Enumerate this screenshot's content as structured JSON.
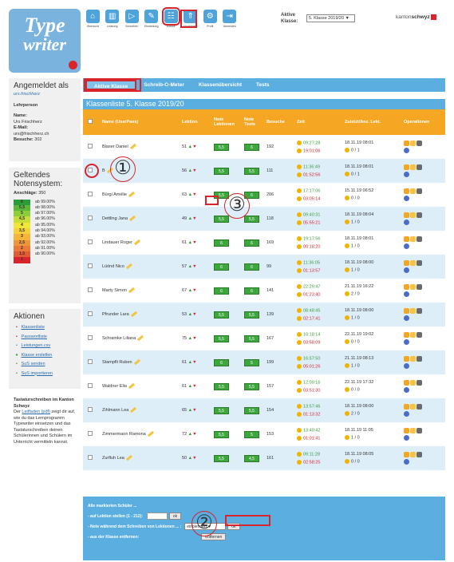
{
  "logo": {
    "line1": "Type",
    "line2": "writer"
  },
  "nav": [
    {
      "label": "Übersicht",
      "icon": "⌂"
    },
    {
      "label": "Leistung",
      "icon": "▥"
    },
    {
      "label": "Schreiben",
      "icon": "▷"
    },
    {
      "label": "Einstellung",
      "icon": "✎"
    },
    {
      "label": "Klasse",
      "icon": "☷"
    },
    {
      "label": "Hochladen",
      "icon": "⇑"
    },
    {
      "label": "Profil",
      "icon": "⚙"
    },
    {
      "label": "Abmelden",
      "icon": "⇥"
    }
  ],
  "klasse": {
    "label": "Aktive\nKlasse:",
    "value": "5. Klasse 2019/20 ▼"
  },
  "brand": {
    "text": "kanton",
    "bold": "schwyz"
  },
  "sidebar": {
    "heading": "Angemeldet als",
    "user": "urs.frischherz",
    "role": "Lehrperson",
    "name_label": "Name:",
    "name": "Urs Frischherz",
    "email_label": "E-Mail:",
    "email": "urs@frischherz.ch",
    "visits_label": "Besuche:",
    "visits": "302",
    "grading_heading": "Geltendes Notensystem:",
    "keystrokes_label": "Anschläge:",
    "keystrokes": "350",
    "notes": [
      {
        "g": "6",
        "p": "ab 99.00%",
        "c": "#2a9d3a"
      },
      {
        "g": "5,5",
        "p": "ab 98.00%",
        "c": "#5cb83a"
      },
      {
        "g": "5",
        "p": "ab 97.00%",
        "c": "#8ccd3a"
      },
      {
        "g": "4,5",
        "p": "ab 96.00%",
        "c": "#c8dc3a"
      },
      {
        "g": "4",
        "p": "ab 95.00%",
        "c": "#f0e63a"
      },
      {
        "g": "3,5",
        "p": "ab 94.00%",
        "c": "#f5d03a"
      },
      {
        "g": "3",
        "p": "ab 93.00%",
        "c": "#f5b43a"
      },
      {
        "g": "2,5",
        "p": "ab 92.00%",
        "c": "#f0963a"
      },
      {
        "g": "2",
        "p": "ab 91.00%",
        "c": "#eb7a3a"
      },
      {
        "g": "1,5",
        "p": "ab 90.00%",
        "c": "#e45a34"
      },
      {
        "g": "1",
        "p": "",
        "c": "#d8242b"
      }
    ],
    "actions_heading": "Aktionen",
    "actions": [
      {
        "label": "Klassenliste",
        "icon": "▪",
        "c": "#d8242b"
      },
      {
        "label": "Passwortliste",
        "icon": "▪",
        "c": "#d8242b"
      },
      {
        "label": "Leistungen.csv",
        "icon": "▪",
        "c": "#5a8ec8"
      },
      {
        "label": "Klasse erstellen",
        "icon": "●",
        "c": "#3a9d3a"
      },
      {
        "label": "SuS senden",
        "icon": "▪",
        "c": "#6a8a4a"
      },
      {
        "label": "SuS importieren",
        "icon": "▪",
        "c": "#6a8a4a"
      }
    ],
    "info_heading": "Tastaturschreiben im Kanton Schwyz",
    "info_pre": "Der",
    "info_link": "Leitfaden (pdf)",
    "info_post": "zeigt dir auf, wie du das Lernprogramm Typewriter einsetzen und das Tastaturschreiben deinen Schülerinnen und Schülern im Unterricht vermitteln kannst."
  },
  "tabs": [
    "Aktive Klasse",
    "Schreib-O-Meter",
    "Klassenübersicht",
    "Tests"
  ],
  "list_title": "Klassenliste 5. Klasse 2019/20",
  "headers": {
    "name": "Name (UserPass)",
    "lektion": "Lektion",
    "note_lek": "Note Lektionen",
    "note_tests": "Note Tests",
    "besuche": "Besuche",
    "zeit": "Zeit",
    "zuletzt": "Zuletzt/Anz. Lekt.",
    "op": "Operationen"
  },
  "students": [
    {
      "name": "Blaser Daniel",
      "lek": "51",
      "nl": "5,5",
      "nt": "6",
      "bes": "192",
      "t1": "09:27:28",
      "t2": "19:01:06",
      "last": "18.11.19 08:01",
      "cnt": "0 / 1"
    },
    {
      "name": "B",
      "lek": "56",
      "nl": "5,5",
      "nt": "5,5",
      "bes": "111",
      "t1": "11:36:49",
      "t2": "01:52:56",
      "last": "18.11.19 08:01",
      "cnt": "0 / 1"
    },
    {
      "name": "Bürgi Amélie",
      "lek": "63",
      "nl": "5,5",
      "nt": "6",
      "bes": "206",
      "t1": "17:17:06",
      "t2": "03:05:14",
      "last": "15.11.19 06:52",
      "cnt": "0 / 0"
    },
    {
      "name": "Dettling Jana",
      "lek": "49",
      "nl": "5,5",
      "nt": "5,5",
      "bes": "118",
      "t1": "09:40:31",
      "t2": "05:55:21",
      "last": "18.11.19 08:04",
      "cnt": "1 / 0"
    },
    {
      "name": "Lindauer Roger",
      "lek": "61",
      "nl": "6",
      "nt": "6",
      "bes": "169",
      "t1": "19:17:56",
      "t2": "00:18:20",
      "last": "18.11.19 08:01",
      "cnt": "1 / 0"
    },
    {
      "name": "Lüönd Nico",
      "lek": "57",
      "nl": "6",
      "nt": "6",
      "bes": "99",
      "t1": "11:36:05",
      "t2": "01:13:57",
      "last": "18.11.19 08:00",
      "cnt": "1 / 0"
    },
    {
      "name": "Marty Simon",
      "lek": "67",
      "nl": "6",
      "nt": "6",
      "bes": "141",
      "t1": "22:29:47",
      "t2": "01:23:40",
      "last": "21.11.19 16:22",
      "cnt": "2 / 0"
    },
    {
      "name": "Pfrunder Lara",
      "lek": "53",
      "nl": "5,5",
      "nt": "5,5",
      "bes": "139",
      "t1": "08:48:45",
      "t2": "02:17:41",
      "last": "18.11.19 08:00",
      "cnt": "1 / 0"
    },
    {
      "name": "Schramke Liliana",
      "lek": "75",
      "nl": "5,5",
      "nt": "5,5",
      "bes": "167",
      "t1": "10:18:14",
      "t2": "03:58:09",
      "last": "22.11.19 19:02",
      "cnt": "0 / 0"
    },
    {
      "name": "Stampfli Ruben",
      "lek": "61",
      "nl": "6",
      "nt": "5",
      "bes": "199",
      "t1": "16:57:50",
      "t2": "05:01:26",
      "last": "21.11.19 08:13",
      "cnt": "1 / 0"
    },
    {
      "name": "Waldner Elia",
      "lek": "61",
      "nl": "5,5",
      "nt": "5,5",
      "bes": "157",
      "t1": "12:09:16",
      "t2": "03:51:30",
      "last": "22.11.19 17:32",
      "cnt": "0 / 0"
    },
    {
      "name": "Zihlmann Lea",
      "lek": "65",
      "nl": "5,5",
      "nt": "5,5",
      "bes": "154",
      "t1": "13:57:46",
      "t2": "01:13:32",
      "last": "18.11.19 08:00",
      "cnt": "2 / 0"
    },
    {
      "name": "Zimmermann Ramona",
      "lek": "72",
      "nl": "5,5",
      "nt": "5",
      "bes": "153",
      "t1": "13:40:42",
      "t2": "01:01:41",
      "last": "18.11.19 11:05",
      "cnt": "1 / 0"
    },
    {
      "name": "Zurfluh Lea",
      "lek": "50",
      "nl": "5,5",
      "nt": "4,5",
      "bes": "161",
      "t1": "09:11:28",
      "t2": "02:58:25",
      "last": "18.11.19 08:05",
      "cnt": "0 / 0"
    }
  ],
  "bottom": {
    "heading": "Alle markierten Schüler ...",
    "row1": "- auf Lektion stellen (1 - 212):",
    "ok": "ok",
    "row2": "- Note während dem Schreiben von Lektionen ... :",
    "row2_select": "einblenden ▼",
    "row3": "- aus der Klasse entfernen:",
    "remove": "entfernen"
  },
  "annotations": [
    "①",
    "②",
    "③"
  ]
}
